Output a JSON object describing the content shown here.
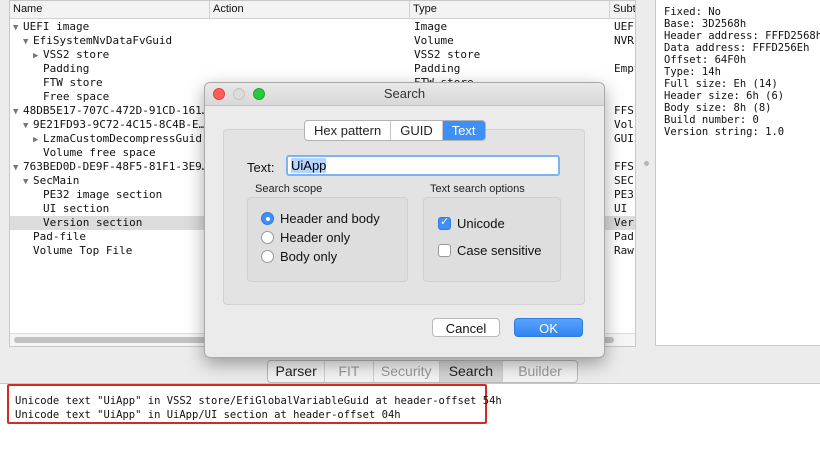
{
  "tree": {
    "columns": [
      "Name",
      "Action",
      "Type",
      "Subt"
    ],
    "rows": [
      {
        "indent": 0,
        "arrow": "down",
        "name": "UEFI image",
        "action": "",
        "type": "Image",
        "subtype": "UEFI"
      },
      {
        "indent": 1,
        "arrow": "down",
        "name": "EfiSystemNvDataFvGuid",
        "action": "",
        "type": "Volume",
        "subtype": "NVR"
      },
      {
        "indent": 2,
        "arrow": "right",
        "name": "VSS2 store",
        "action": "",
        "type": "VSS2 store",
        "subtype": ""
      },
      {
        "indent": 2,
        "arrow": "",
        "name": "Padding",
        "action": "",
        "type": "Padding",
        "subtype": "Empt"
      },
      {
        "indent": 2,
        "arrow": "",
        "name": "FTW store",
        "action": "",
        "type": "FTW store",
        "subtype": ""
      },
      {
        "indent": 2,
        "arrow": "",
        "name": "Free space",
        "action": "",
        "type": "",
        "subtype": ""
      },
      {
        "indent": 0,
        "arrow": "down",
        "name": "48DB5E17-707C-472D-91CD-161…",
        "action": "",
        "type": "",
        "subtype": "FFS"
      },
      {
        "indent": 1,
        "arrow": "down",
        "name": "9E21FD93-9C72-4C15-8C4B-E…",
        "action": "",
        "type": "",
        "subtype": "Vol"
      },
      {
        "indent": 2,
        "arrow": "right",
        "name": "LzmaCustomDecompressGuid",
        "action": "",
        "type": "",
        "subtype": "GUI"
      },
      {
        "indent": 2,
        "arrow": "",
        "name": "Volume free space",
        "action": "",
        "type": "",
        "subtype": ""
      },
      {
        "indent": 0,
        "arrow": "down",
        "name": "763BED0D-DE9F-48F5-81F1-3E9…",
        "action": "",
        "type": "",
        "subtype": "FFS"
      },
      {
        "indent": 1,
        "arrow": "down",
        "name": "SecMain",
        "action": "",
        "type": "",
        "subtype": "SEC"
      },
      {
        "indent": 2,
        "arrow": "",
        "name": "PE32 image section",
        "action": "",
        "type": "",
        "subtype": "PE3"
      },
      {
        "indent": 2,
        "arrow": "",
        "name": "UI section",
        "action": "",
        "type": "",
        "subtype": "UI"
      },
      {
        "indent": 2,
        "arrow": "",
        "name": "Version section",
        "action": "",
        "type": "",
        "subtype": "Ver",
        "selected": true
      },
      {
        "indent": 1,
        "arrow": "",
        "name": "Pad-file",
        "action": "",
        "type": "",
        "subtype": "Pad"
      },
      {
        "indent": 1,
        "arrow": "",
        "name": "Volume Top File",
        "action": "",
        "type": "",
        "subtype": "Raw"
      }
    ]
  },
  "info": {
    "lines": [
      "Fixed: No",
      "Base: 3D2568h",
      "Header address: FFFD2568h",
      "Data address: FFFD256Eh",
      "Offset: 64F0h",
      "Type: 14h",
      "Full size: Eh (14)",
      "Header size: 6h (6)",
      "Body size: 8h (8)",
      "Build number: 0",
      "Version string: 1.0"
    ]
  },
  "bottom_tabs": [
    {
      "label": "Parser",
      "enabled": true,
      "active": false
    },
    {
      "label": "FIT",
      "enabled": false,
      "active": false
    },
    {
      "label": "Security",
      "enabled": false,
      "active": false
    },
    {
      "label": "Search",
      "enabled": true,
      "active": true
    },
    {
      "label": "Builder",
      "enabled": false,
      "active": false
    }
  ],
  "messages": [
    "Unicode text \"UiApp\" in VSS2 store/EfiGlobalVariableGuid at header-offset 54h",
    "Unicode text \"UiApp\" in UiApp/UI section at header-offset 04h"
  ],
  "dialog": {
    "title": "Search",
    "segments": [
      {
        "label": "Hex pattern",
        "active": false
      },
      {
        "label": "GUID",
        "active": false
      },
      {
        "label": "Text",
        "active": true
      }
    ],
    "text_label": "Text:",
    "text_value": "UiApp",
    "scope_title": "Search scope",
    "scope_options": [
      {
        "label": "Header and body",
        "selected": true
      },
      {
        "label": "Header only",
        "selected": false
      },
      {
        "label": "Body only",
        "selected": false
      }
    ],
    "options_title": "Text search options",
    "options": [
      {
        "label": "Unicode",
        "checked": true
      },
      {
        "label": "Case sensitive",
        "checked": false
      }
    ],
    "cancel_label": "Cancel",
    "ok_label": "OK"
  },
  "colors": {
    "accent": "#3e8ff6",
    "highlight_border": "#d42a20",
    "close": "#fe5f57",
    "minimize": "#febc2e",
    "zoom": "#28c840"
  }
}
